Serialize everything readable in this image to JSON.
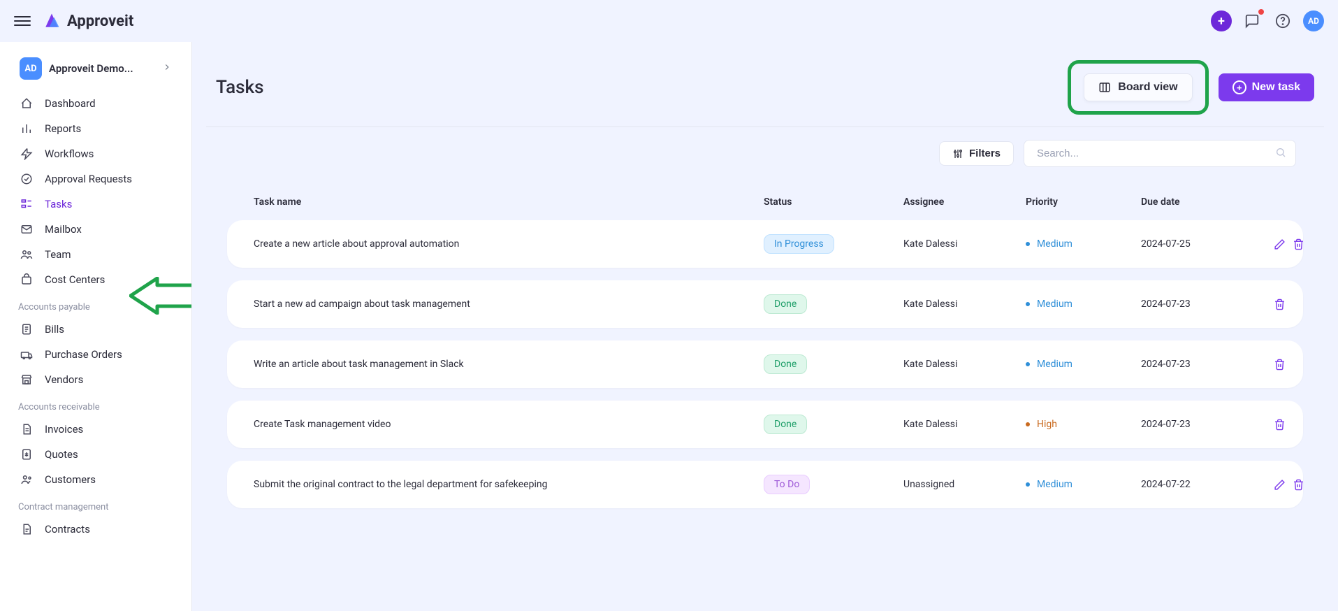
{
  "app": {
    "name": "Approveit",
    "avatar_initials": "AD"
  },
  "workspace": {
    "initials": "AD",
    "name": "Approveit Demo..."
  },
  "sidebar": {
    "items": [
      {
        "label": "Dashboard"
      },
      {
        "label": "Reports"
      },
      {
        "label": "Workflows"
      },
      {
        "label": "Approval Requests"
      },
      {
        "label": "Tasks"
      },
      {
        "label": "Mailbox"
      },
      {
        "label": "Team"
      },
      {
        "label": "Cost Centers"
      }
    ],
    "sections": {
      "payable": {
        "title": "Accounts payable",
        "items": [
          {
            "label": "Bills"
          },
          {
            "label": "Purchase Orders"
          },
          {
            "label": "Vendors"
          }
        ]
      },
      "receivable": {
        "title": "Accounts receivable",
        "items": [
          {
            "label": "Invoices"
          },
          {
            "label": "Quotes"
          },
          {
            "label": "Customers"
          }
        ]
      },
      "contract": {
        "title": "Contract management",
        "items": [
          {
            "label": "Contracts"
          }
        ]
      }
    }
  },
  "page": {
    "title": "Tasks",
    "board_view_label": "Board view",
    "new_task_label": "New task",
    "filters_label": "Filters",
    "search_placeholder": "Search..."
  },
  "columns": {
    "name": "Task name",
    "status": "Status",
    "assignee": "Assignee",
    "priority": "Priority",
    "due": "Due date"
  },
  "tasks": [
    {
      "name": "Create a new article about approval automation",
      "status": "In Progress",
      "status_class": "st-inprogress",
      "assignee": "Kate Dalessi",
      "priority": "Medium",
      "priority_class": "",
      "due": "2024-07-25",
      "show_edit": true
    },
    {
      "name": "Start a new ad campaign about task management",
      "status": "Done",
      "status_class": "st-done",
      "assignee": "Kate Dalessi",
      "priority": "Medium",
      "priority_class": "",
      "due": "2024-07-23",
      "show_edit": false
    },
    {
      "name": "Write an article about task management in Slack",
      "status": "Done",
      "status_class": "st-done",
      "assignee": "Kate Dalessi",
      "priority": "Medium",
      "priority_class": "",
      "due": "2024-07-23",
      "show_edit": false
    },
    {
      "name": "Create Task management video",
      "status": "Done",
      "status_class": "st-done",
      "assignee": "Kate Dalessi",
      "priority": "High",
      "priority_class": "prio-high",
      "due": "2024-07-23",
      "show_edit": false
    },
    {
      "name": "Submit the original contract to the legal department for safekeeping",
      "status": "To Do",
      "status_class": "st-todo",
      "assignee": "Unassigned",
      "priority": "Medium",
      "priority_class": "",
      "due": "2024-07-22",
      "show_edit": true
    }
  ]
}
